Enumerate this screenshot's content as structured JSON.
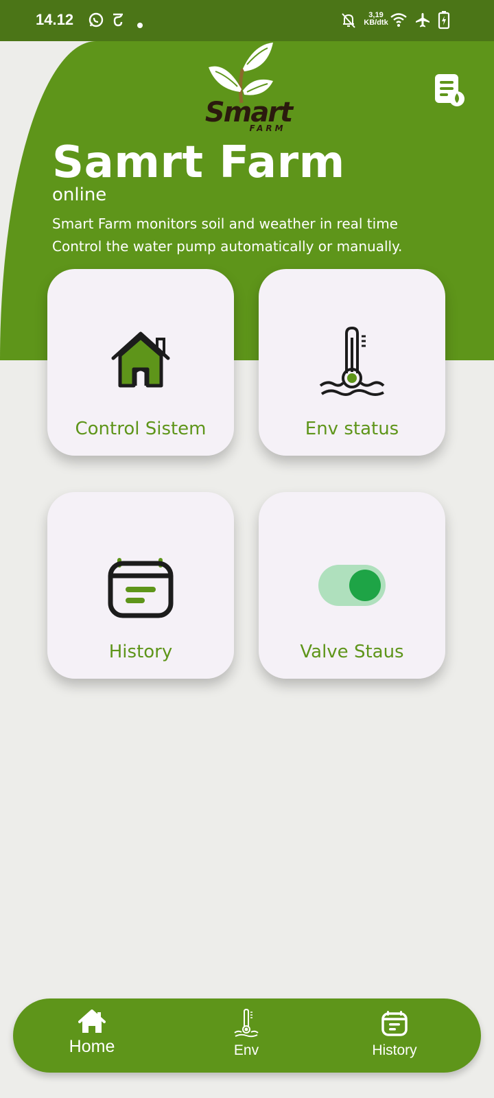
{
  "status_bar": {
    "time": "14.12",
    "net_speed_value": "3,19",
    "net_speed_unit": "KB/dtk"
  },
  "header": {
    "logo_word": "Smart",
    "logo_sub": "FARM",
    "title": "Samrt Farm",
    "status": "online",
    "description_line1": "Smart Farm monitors soil and weather in real time",
    "description_line2": "Control the water pump automatically or manually."
  },
  "cards": [
    {
      "label": "Control Sistem",
      "icon": "house-icon"
    },
    {
      "label": "Env status",
      "icon": "thermometer-icon"
    },
    {
      "label": "History",
      "icon": "calendar-icon"
    },
    {
      "label": "Valve Staus",
      "icon": "toggle-icon"
    }
  ],
  "nav": [
    {
      "label": "Home",
      "icon": "home-icon"
    },
    {
      "label": "Env",
      "icon": "thermometer-icon"
    },
    {
      "label": "History",
      "icon": "calendar-icon"
    }
  ],
  "colors": {
    "primary": "#5e951a",
    "status_bar": "#4b7517",
    "background": "#ededea",
    "card": "#f5f1f7",
    "accent_green": "#1ea446"
  }
}
